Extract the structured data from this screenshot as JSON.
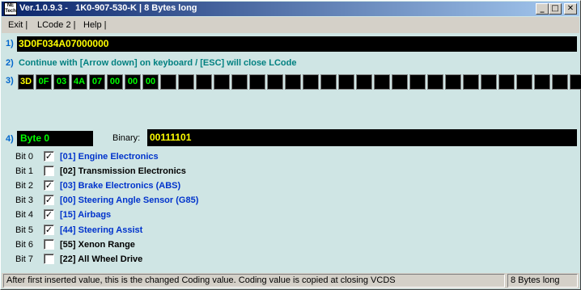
{
  "window": {
    "title": "Ver.1.0.9.3 -   1K0-907-530-K | 8 Bytes long",
    "icon_text": "NE Tech",
    "minimize": "_",
    "maximize": "□",
    "close": "✕"
  },
  "menu": [
    "Exit |",
    "LCode 2 |",
    "Help |"
  ],
  "numbers": [
    "1)",
    "2)",
    "3)",
    "4)"
  ],
  "coding_value": "3D0F034A07000000",
  "hint": "Continue with [Arrow down] on keyboard / [ESC] will close LCode",
  "bytes": [
    "3D",
    "0F",
    "03",
    "4A",
    "07",
    "00",
    "00",
    "00",
    "",
    "",
    "",
    "",
    "",
    "",
    "",
    "",
    "",
    "",
    "",
    "",
    "",
    "",
    "",
    "",
    "",
    "",
    "",
    "",
    "",
    "",
    "",
    ""
  ],
  "byte_label": "Byte 0",
  "binary_label": "Binary:",
  "binary_value": "00111101",
  "bits": [
    {
      "name": "Bit 0",
      "checked": true,
      "desc": "[01] Engine Electronics"
    },
    {
      "name": "Bit 1",
      "checked": false,
      "desc": "[02] Transmission Electronics"
    },
    {
      "name": "Bit 2",
      "checked": true,
      "desc": "[03] Brake Electronics (ABS)"
    },
    {
      "name": "Bit 3",
      "checked": true,
      "desc": "[00] Steering Angle Sensor (G85)"
    },
    {
      "name": "Bit 4",
      "checked": true,
      "desc": "[15] Airbags"
    },
    {
      "name": "Bit 5",
      "checked": true,
      "desc": "[44] Steering Assist"
    },
    {
      "name": "Bit 6",
      "checked": false,
      "desc": "[55] Xenon Range"
    },
    {
      "name": "Bit 7",
      "checked": false,
      "desc": "[22] All Wheel Drive"
    }
  ],
  "status": {
    "message": "After first inserted value, this is the changed Coding value.  Coding value is copied at closing VCDS",
    "length": "8 Bytes long"
  },
  "colors": {
    "accent_on": "#0033cc",
    "value_yellow": "#ffff00",
    "byte_green": "#00ff00",
    "hint_teal": "#008080"
  }
}
